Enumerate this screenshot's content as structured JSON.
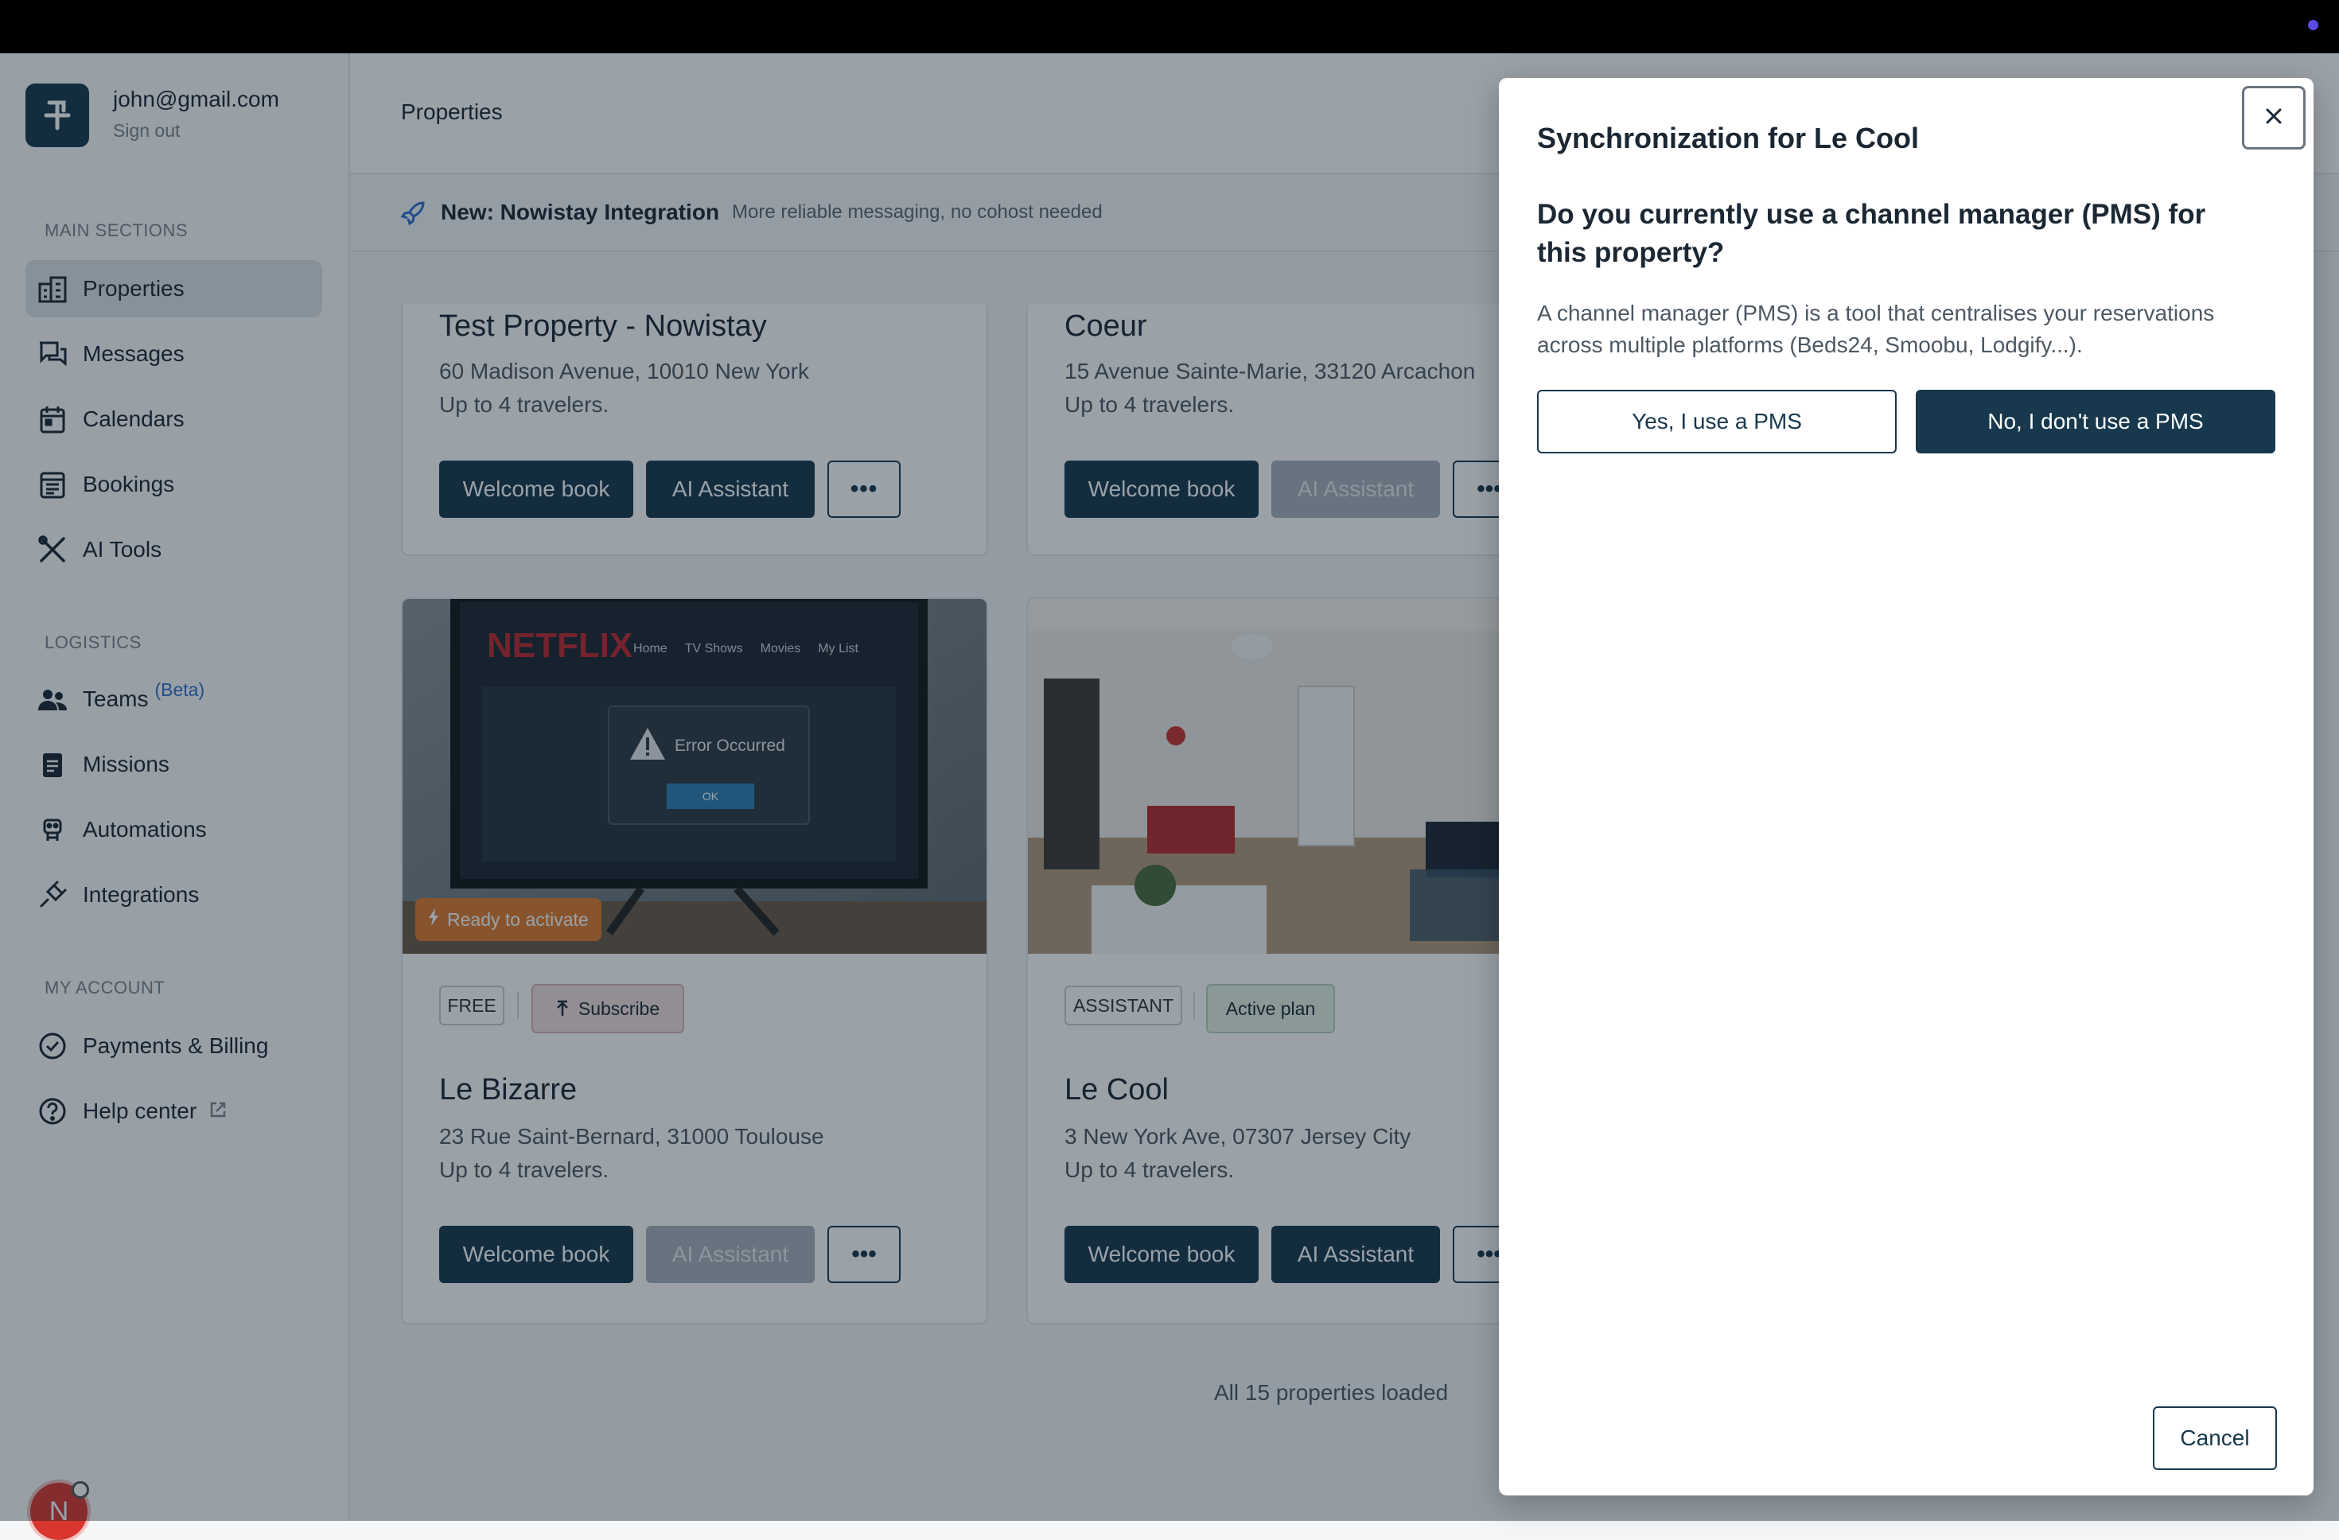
{
  "sidebar": {
    "email": "john@gmail.com",
    "sign_out": "Sign out",
    "sections": {
      "main": "MAIN SECTIONS",
      "logistics": "LOGISTICS",
      "account": "MY ACCOUNT"
    },
    "main_items": [
      {
        "label": "Properties",
        "icon": "building-icon"
      },
      {
        "label": "Messages",
        "icon": "chat-icon"
      },
      {
        "label": "Calendars",
        "icon": "calendar-icon"
      },
      {
        "label": "Bookings",
        "icon": "bookings-icon"
      },
      {
        "label": "AI Tools",
        "icon": "tools-icon"
      }
    ],
    "logistics_items": [
      {
        "label": "Teams",
        "icon": "team-icon",
        "badge": "(Beta)"
      },
      {
        "label": "Missions",
        "icon": "clipboard-icon"
      },
      {
        "label": "Automations",
        "icon": "robot-icon"
      },
      {
        "label": "Integrations",
        "icon": "plug-icon"
      }
    ],
    "account_items": [
      {
        "label": "Payments & Billing",
        "icon": "billing-icon"
      },
      {
        "label": "Help center",
        "icon": "help-icon"
      }
    ],
    "avatar_letter": "N"
  },
  "header": {
    "title": "Properties"
  },
  "banner": {
    "title": "New: Nowistay Integration",
    "subtitle": "More reliable messaging, no cohost needed"
  },
  "properties": [
    {
      "name": "Test Property - Nowistay",
      "address": "60 Madison Avenue, 10010 New York",
      "capacity": "Up to 4 travelers.",
      "welcome": "Welcome book",
      "assistant": "AI Assistant"
    },
    {
      "name": "Coeur",
      "address": "15 Avenue Sainte-Marie, 33120 Arcachon",
      "capacity": "Up to 4 travelers.",
      "welcome": "Welcome book",
      "assistant": "AI Assistant"
    },
    {
      "name": "Le Bizarre",
      "address": "23 Rue Saint-Bernard, 31000 Toulouse",
      "capacity": "Up to 4 travelers.",
      "welcome": "Welcome book",
      "assistant": "AI Assistant",
      "plan": "FREE",
      "action": "Subscribe",
      "status": "Ready to activate"
    },
    {
      "name": "Le Cool",
      "address": "3 New York Ave, 07307 Jersey City",
      "capacity": "Up to 4 travelers.",
      "welcome": "Welcome book",
      "assistant": "AI Assistant",
      "plan": "ASSISTANT",
      "action": "Active plan"
    }
  ],
  "tv_screen": {
    "brand": "NETFLIX",
    "menu": [
      "Home",
      "TV Shows",
      "Movies",
      "My List"
    ],
    "error": "Error Occurred",
    "ok": "OK"
  },
  "footer_status": "All 15 properties loaded",
  "modal": {
    "title": "Synchronization for Le Cool",
    "question": "Do you currently use a channel manager (PMS) for this property?",
    "description": "A channel manager (PMS) is a tool that centralises your reservations across multiple platforms (Beds24, Smoobu, Lodgify...).",
    "yes_label": "Yes, I use a PMS",
    "no_label": "No, I don't use a PMS",
    "cancel_label": "Cancel"
  }
}
